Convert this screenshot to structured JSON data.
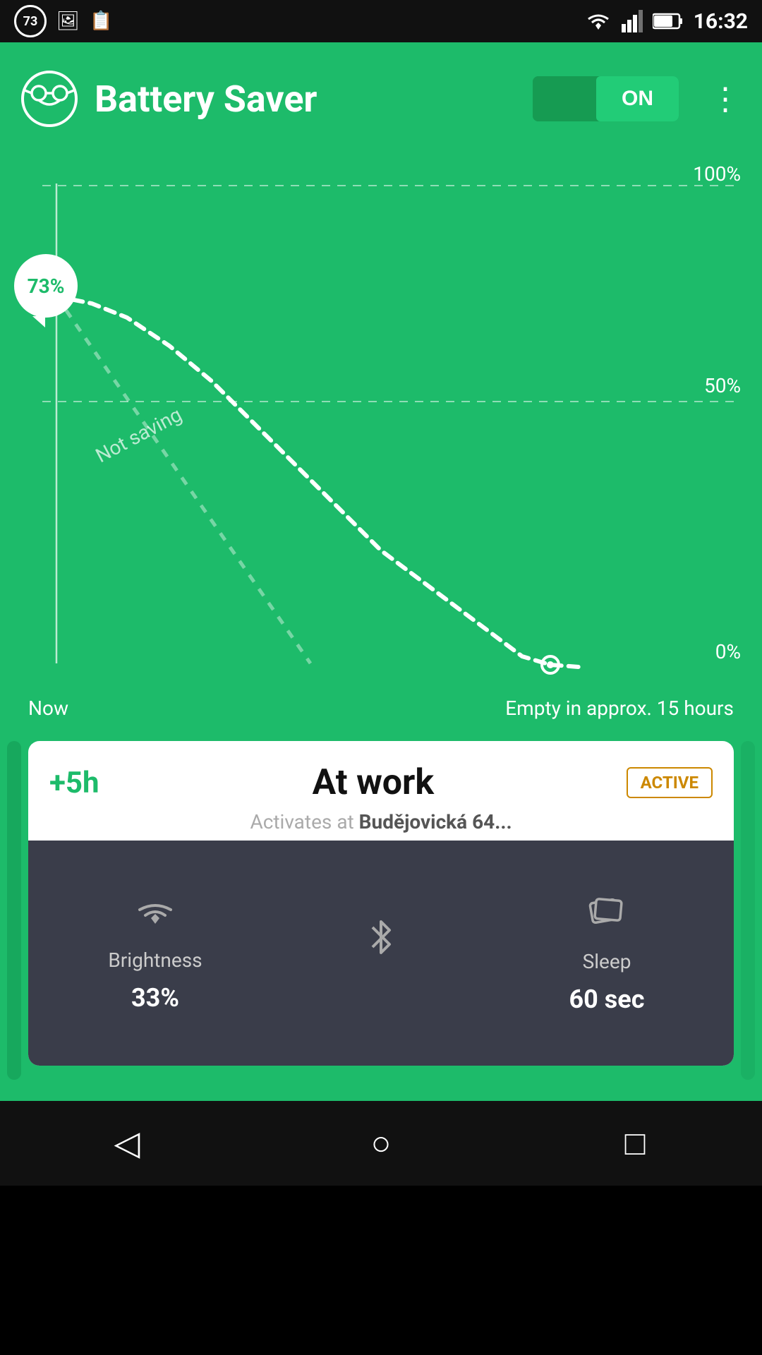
{
  "statusBar": {
    "leftCircle": "73",
    "time": "16:32"
  },
  "header": {
    "title": "Battery Saver",
    "toggleState": "ON",
    "moreIcon": "⋮"
  },
  "chart": {
    "batteryPercent": "73%",
    "label100": "100%",
    "label50": "50%",
    "label0": "0%",
    "labelNow": "Now",
    "labelEmpty": "Empty in approx. 15 hours",
    "notSaving": "Not saving"
  },
  "card": {
    "timeGain": "+5h",
    "title": "At work",
    "activeBadge": "ACTIVE",
    "subtitle": "Activates at",
    "location": "Budějovická 64...",
    "features": [
      {
        "icon": "wifi",
        "label": "Brightness",
        "value": "33%"
      },
      {
        "icon": "bluetooth",
        "label": "",
        "value": ""
      },
      {
        "icon": "cards",
        "label": "Sleep",
        "value": "60 sec"
      }
    ]
  },
  "bottomNav": {
    "back": "◁",
    "home": "○",
    "recent": "□"
  }
}
